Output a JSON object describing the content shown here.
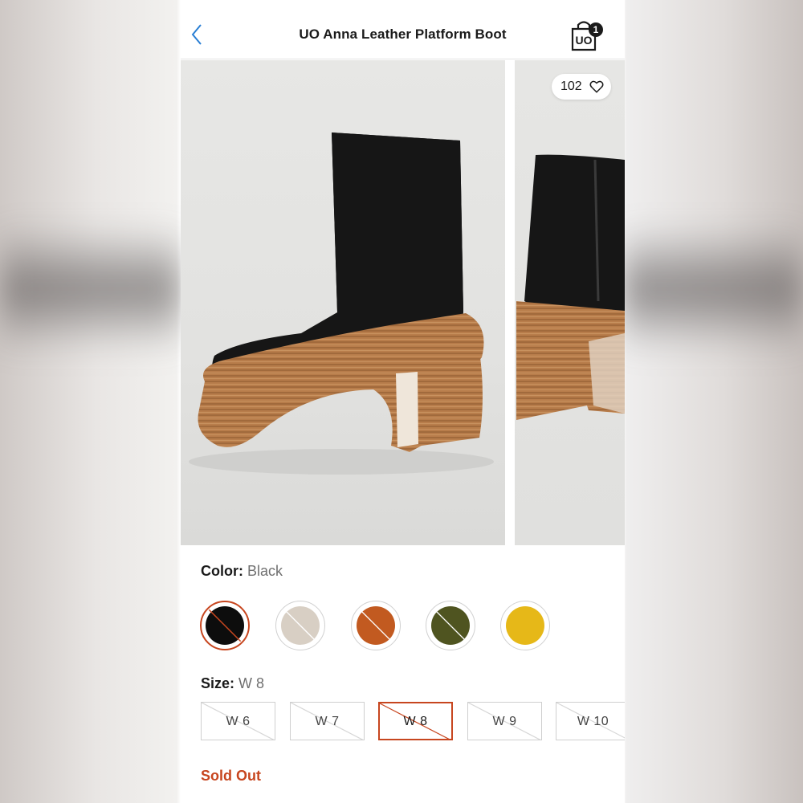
{
  "header": {
    "title": "UO Anna Leather Platform Boot",
    "bag_logo": "UO",
    "bag_count": "1",
    "back_icon": "chevron-left-icon",
    "bag_icon": "shopping-bag-icon"
  },
  "gallery": {
    "favorite_count": "102",
    "favorite_icon": "heart-icon"
  },
  "color": {
    "label": "Color:",
    "selected": "Black",
    "swatches": [
      {
        "name": "black",
        "hex": "#0d0d0d",
        "unavailable": true,
        "selected": true
      },
      {
        "name": "beige",
        "hex": "#d8cfc4",
        "unavailable": true,
        "selected": false
      },
      {
        "name": "rust",
        "hex": "#c25a20",
        "unavailable": true,
        "selected": false
      },
      {
        "name": "olive",
        "hex": "#4f5420",
        "unavailable": true,
        "selected": false
      },
      {
        "name": "yellow",
        "hex": "#e6b818",
        "unavailable": false,
        "selected": false
      }
    ]
  },
  "size": {
    "label": "Size:",
    "selected": "W 8",
    "options": [
      "W 6",
      "W 7",
      "W 8",
      "W 9",
      "W 10"
    ]
  },
  "status_text": "Sold Out",
  "colors": {
    "accent": "#c7461f",
    "link_blue": "#2a7fd4"
  }
}
